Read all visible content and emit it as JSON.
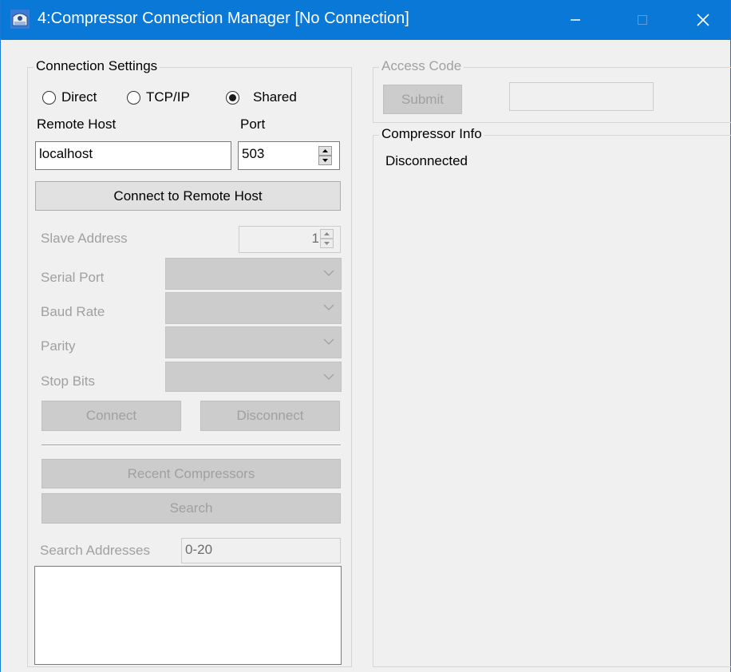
{
  "window": {
    "title": "4:Compressor Connection Manager [No Connection]",
    "colors": {
      "titlebar": "#0a78d7",
      "background": "#f0f0f0"
    },
    "icons": [
      "app-icon",
      "minimize-icon",
      "maximize-icon",
      "close-icon"
    ]
  },
  "connection_settings": {
    "legend": "Connection Settings",
    "modes": [
      {
        "label": "Direct",
        "selected": false
      },
      {
        "label": "TCP/IP",
        "selected": false
      },
      {
        "label": "Shared",
        "selected": true
      }
    ],
    "remote_host_label": "Remote Host",
    "remote_host_value": "localhost",
    "port_label": "Port",
    "port_value": "503",
    "connect_remote_label": "Connect to Remote Host",
    "slave_address_label": "Slave Address",
    "slave_address_value": "1",
    "serial_port_label": "Serial Port",
    "baud_rate_label": "Baud Rate",
    "parity_label": "Parity",
    "stop_bits_label": "Stop Bits",
    "connect_label": "Connect",
    "disconnect_label": "Disconnect",
    "recent_compressors_label": "Recent Compressors",
    "search_label": "Search",
    "search_addresses_label": "Search Addresses",
    "search_addresses_value": "0-20"
  },
  "access_code": {
    "legend": "Access Code",
    "submit_label": "Submit",
    "value": ""
  },
  "compressor_info": {
    "legend": "Compressor Info",
    "status": "Disconnected"
  }
}
